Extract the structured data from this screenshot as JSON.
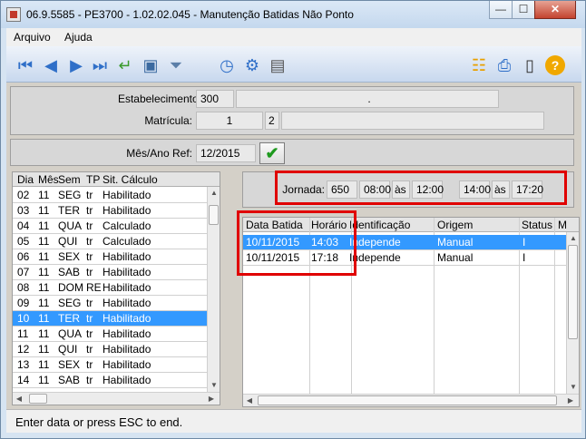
{
  "window": {
    "title": "06.9.5585 - PE3700 - 1.02.02.045 - Manutenção Batidas Não Ponto",
    "minimize": "—",
    "maximize": "☐",
    "close": "✕"
  },
  "menu": {
    "items": [
      "Arquivo",
      "Ajuda"
    ]
  },
  "toolbar": {
    "icons": [
      "first-record-icon",
      "previous-record-icon",
      "next-record-icon",
      "last-record-icon",
      "return-icon",
      "zoom-icon",
      "filter-icon",
      "clock-icon",
      "clock-settings-icon",
      "document-clock-icon",
      "tree-structure-icon",
      "print-icon",
      "exit-door-icon",
      "help-icon"
    ]
  },
  "header": {
    "estabelecimento_label": "Estabelecimento:",
    "estabelecimento_code": "300",
    "estabelecimento_name": "",
    "estabelecimento_extra": ".",
    "matricula_label": "Matrícula:",
    "matricula_code": "1",
    "matricula_dv": "2",
    "matricula_name": ""
  },
  "period": {
    "label": "Mês/Ano Ref:",
    "value": "12/2015"
  },
  "days_grid": {
    "columns": [
      "Dia",
      "Mês",
      "Sem",
      "TP",
      "Sit. Cálculo"
    ],
    "rows": [
      [
        "02",
        "11",
        "SEG",
        "tr",
        "Habilitado"
      ],
      [
        "03",
        "11",
        "TER",
        "tr",
        "Habilitado"
      ],
      [
        "04",
        "11",
        "QUA",
        "tr",
        "Calculado"
      ],
      [
        "05",
        "11",
        "QUI",
        "tr",
        "Calculado"
      ],
      [
        "06",
        "11",
        "SEX",
        "tr",
        "Habilitado"
      ],
      [
        "07",
        "11",
        "SAB",
        "tr",
        "Habilitado"
      ],
      [
        "08",
        "11",
        "DOM",
        "RE",
        "Habilitado"
      ],
      [
        "09",
        "11",
        "SEG",
        "tr",
        "Habilitado"
      ],
      [
        "10",
        "11",
        "TER",
        "tr",
        "Habilitado"
      ],
      [
        "11",
        "11",
        "QUA",
        "tr",
        "Habilitado"
      ],
      [
        "12",
        "11",
        "QUI",
        "tr",
        "Habilitado"
      ],
      [
        "13",
        "11",
        "SEX",
        "tr",
        "Habilitado"
      ],
      [
        "14",
        "11",
        "SAB",
        "tr",
        "Habilitado"
      ]
    ],
    "selected_index": 8
  },
  "jornada": {
    "label": "Jornada:",
    "code": "650",
    "t1": "08:00",
    "as1": "às",
    "t2": "12:00",
    "t3": "14:00",
    "as2": "às",
    "t4": "17:20"
  },
  "punches_grid": {
    "columns": [
      "Data Batida",
      "Horário",
      "Identificação",
      "Origem",
      "Status",
      "M"
    ],
    "rows": [
      [
        "10/11/2015",
        "14:03",
        "Independe",
        "Manual",
        "I"
      ],
      [
        "10/11/2015",
        "17:18",
        "Independe",
        "Manual",
        "I"
      ]
    ],
    "selected_index": 0
  },
  "status_bar": {
    "text": "Enter data or press ESC to end."
  }
}
